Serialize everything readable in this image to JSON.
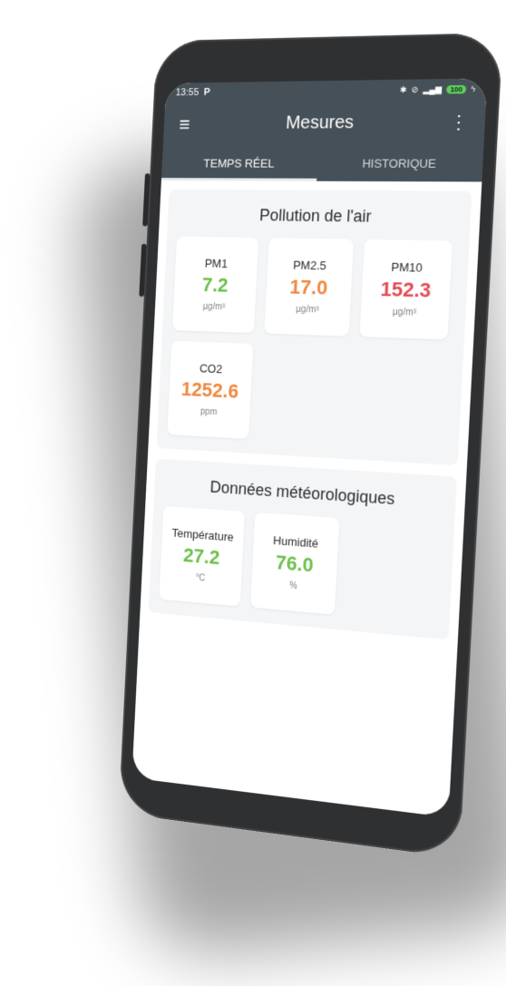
{
  "status": {
    "time": "13:55",
    "carrier_icon": "P",
    "battery": "100"
  },
  "header": {
    "title": "Mesures"
  },
  "tabs": [
    {
      "label": "TEMPS RÉEL",
      "active": true
    },
    {
      "label": "HISTORIQUE",
      "active": false
    }
  ],
  "sections": {
    "air": {
      "title": "Pollution de l'air",
      "tiles": [
        {
          "label": "PM1",
          "value": "7.2",
          "unit": "µg/m³",
          "color": "#6cc04a"
        },
        {
          "label": "PM2.5",
          "value": "17.0",
          "unit": "µg/m³",
          "color": "#f0883f"
        },
        {
          "label": "PM10",
          "value": "152.3",
          "unit": "µg/m³",
          "color": "#e34b55"
        },
        {
          "label": "CO2",
          "value": "1252.6",
          "unit": "ppm",
          "color": "#f0883f"
        }
      ]
    },
    "weather": {
      "title": "Données météorologiques",
      "tiles": [
        {
          "label": "Température",
          "value": "27.2",
          "unit": "°C",
          "color": "#6cc04a"
        },
        {
          "label": "Humidité",
          "value": "76.0",
          "unit": "%",
          "color": "#6cc04a"
        }
      ]
    }
  },
  "icons": {
    "menu": "hamburger-menu-icon",
    "more": "more-vertical-icon",
    "bluetooth": "bluetooth-icon",
    "alarm_off": "alarm-off-icon",
    "signal": "signal-icon"
  }
}
